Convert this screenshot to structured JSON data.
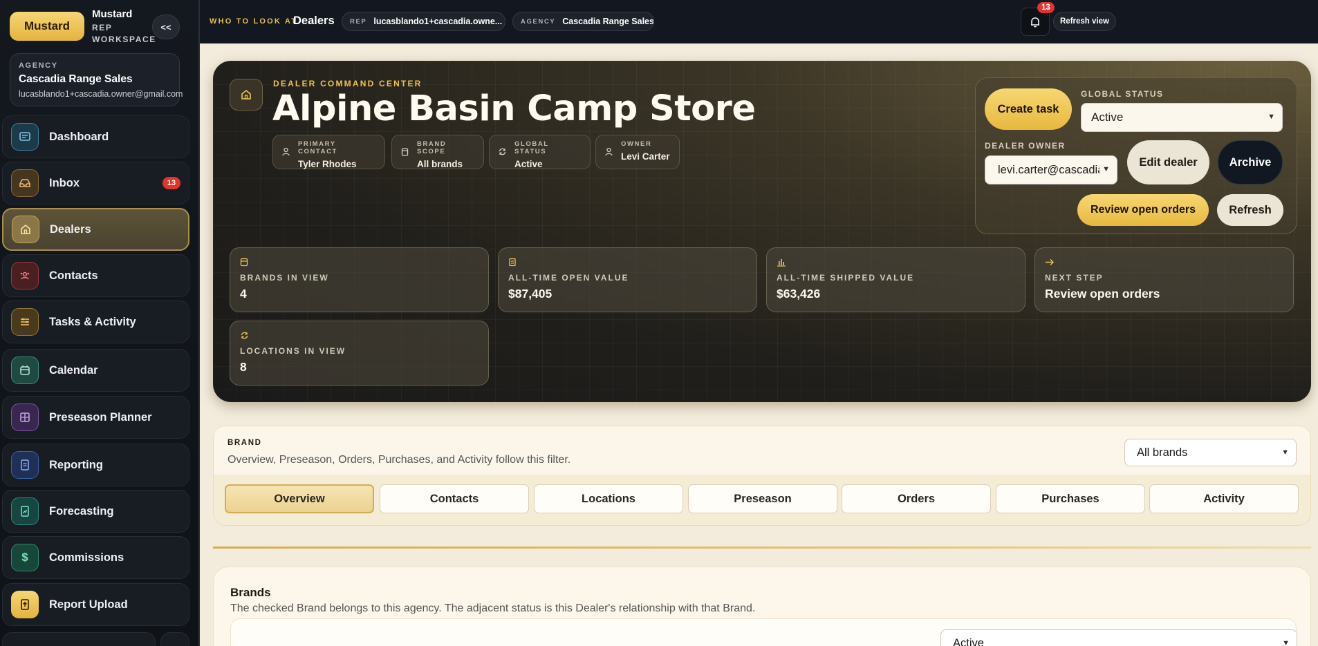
{
  "app": {
    "brand_button": "Mustard",
    "title": "Mustard",
    "subtitle": "REP WORKSPACE",
    "collapse_label": "<<"
  },
  "agency_card": {
    "label": "AGENCY",
    "name": "Cascadia Range Sales",
    "email": "lucasblando1+cascadia.owner@gmail.com"
  },
  "sidebar": {
    "items": [
      {
        "label": "Dashboard",
        "icon": "dashboard-icon"
      },
      {
        "label": "Inbox",
        "icon": "inbox-icon",
        "badge": "13"
      },
      {
        "label": "Dealers",
        "icon": "home-icon",
        "active": true
      },
      {
        "label": "Contacts",
        "icon": "contacts-icon"
      },
      {
        "label": "Tasks & Activity",
        "icon": "tasks-icon"
      },
      {
        "label": "Calendar",
        "icon": "calendar-icon"
      },
      {
        "label": "Preseason Planner",
        "icon": "planner-icon"
      },
      {
        "label": "Reporting",
        "icon": "reporting-icon"
      },
      {
        "label": "Forecasting",
        "icon": "forecasting-icon"
      },
      {
        "label": "Commissions",
        "icon": "dollar-icon"
      },
      {
        "label": "Report Upload",
        "icon": "upload-icon"
      }
    ]
  },
  "topbar": {
    "who_label": "WHO TO LOOK AT",
    "who_value": "Dealers",
    "rep_label": "REP",
    "rep_value": "lucasblando1+cascadia.owne...",
    "agency_label": "AGENCY",
    "agency_value": "Cascadia Range Sales",
    "notifications_count": "13",
    "refresh_view": "Refresh view"
  },
  "hero": {
    "eyebrow": "DEALER COMMAND CENTER",
    "title": "Alpine Basin Camp Store",
    "meta": [
      {
        "label": "PRIMARY CONTACT",
        "value": "Tyler Rhodes",
        "icon": "user-icon"
      },
      {
        "label": "BRAND SCOPE",
        "value": "All brands",
        "icon": "box-icon"
      },
      {
        "label": "GLOBAL STATUS",
        "value": "Active",
        "icon": "refresh-icon"
      },
      {
        "label": "OWNER",
        "value": "Levi Carter",
        "icon": "user-icon"
      }
    ],
    "actions": {
      "create_task": "Create task",
      "global_status_label": "GLOBAL STATUS",
      "global_status_value": "Active",
      "dealer_owner_label": "DEALER OWNER",
      "dealer_owner_value": "levi.carter@cascadia",
      "edit_dealer": "Edit dealer",
      "archive": "Archive",
      "review_open_orders": "Review open orders",
      "refresh": "Refresh"
    },
    "stats": [
      {
        "label": "BRANDS IN VIEW",
        "value": "4",
        "icon": "box-icon"
      },
      {
        "label": "ALL-TIME OPEN VALUE",
        "value": "$87,405",
        "icon": "receipt-icon"
      },
      {
        "label": "ALL-TIME SHIPPED VALUE",
        "value": "$63,426",
        "icon": "bar-chart-icon"
      },
      {
        "label": "NEXT STEP",
        "value": "Review open orders",
        "icon": "arrow-right-icon"
      },
      {
        "label": "LOCATIONS IN VIEW",
        "value": "8",
        "icon": "refresh-icon"
      }
    ]
  },
  "filter": {
    "label": "BRAND",
    "description": "Overview, Preseason, Orders, Purchases, and Activity follow this filter.",
    "selected": "All brands",
    "tabs": [
      "Overview",
      "Contacts",
      "Locations",
      "Preseason",
      "Orders",
      "Purchases",
      "Activity"
    ],
    "active_tab": "Overview"
  },
  "brands_section": {
    "title": "Brands",
    "description": "The checked Brand belongs to this agency. The adjacent status is this Dealer's relationship with that Brand.",
    "row_status": "Active"
  },
  "colors": {
    "accent": "#e7b83f",
    "sidebar_bg": "#14181f",
    "badge": "#e2332e",
    "page_bg": "#f3ecdd"
  }
}
